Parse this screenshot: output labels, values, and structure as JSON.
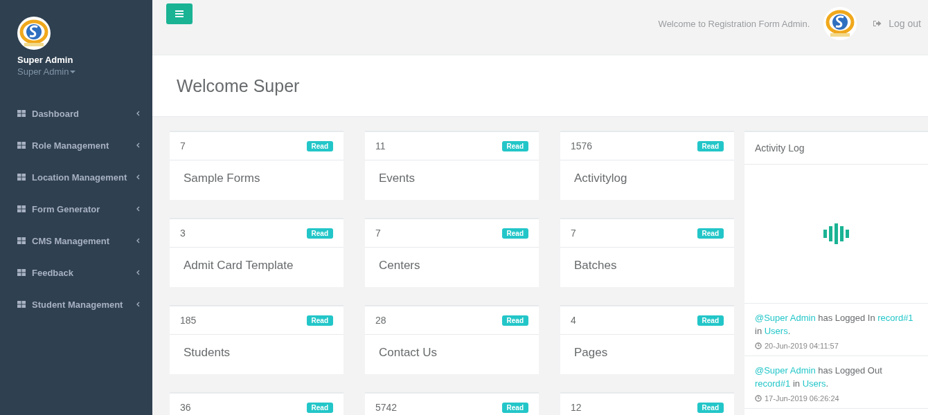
{
  "sidebar": {
    "profile": {
      "name": "Super Admin",
      "role": "Super Admin"
    },
    "items": [
      {
        "label": "Dashboard"
      },
      {
        "label": "Role Management"
      },
      {
        "label": "Location Management"
      },
      {
        "label": "Form Generator"
      },
      {
        "label": "CMS Management"
      },
      {
        "label": "Feedback"
      },
      {
        "label": "Student Management"
      }
    ]
  },
  "topbar": {
    "welcome": "Welcome to Registration Form Admin.",
    "logout": "Log out"
  },
  "page_title": "Welcome Super",
  "cards": [
    {
      "count": "7",
      "badge": "Read",
      "label": "Sample Forms"
    },
    {
      "count": "11",
      "badge": "Read",
      "label": "Events"
    },
    {
      "count": "1576",
      "badge": "Read",
      "label": "Activitylog"
    },
    {
      "count": "3",
      "badge": "Read",
      "label": "Admit Card Template"
    },
    {
      "count": "7",
      "badge": "Read",
      "label": "Centers"
    },
    {
      "count": "7",
      "badge": "Read",
      "label": "Batches"
    },
    {
      "count": "185",
      "badge": "Read",
      "label": "Students"
    },
    {
      "count": "28",
      "badge": "Read",
      "label": "Contact Us"
    },
    {
      "count": "4",
      "badge": "Read",
      "label": "Pages"
    },
    {
      "count": "36",
      "badge": "Read"
    },
    {
      "count": "5742",
      "badge": "Read"
    },
    {
      "count": "12",
      "badge": "Read"
    }
  ],
  "activity_log": {
    "title": "Activity Log",
    "entries": [
      {
        "actor": "@Super Admin",
        "action": "has Logged In",
        "record": "record#1",
        "connector": "in",
        "target": "Users",
        "end": ".",
        "time": "20-Jun-2019 04:11:57"
      },
      {
        "actor": "@Super Admin",
        "action": "has Logged Out",
        "record": "record#1",
        "connector": "in",
        "target": "Users",
        "end": ".",
        "time": "17-Jun-2019 06:26:24"
      }
    ]
  }
}
